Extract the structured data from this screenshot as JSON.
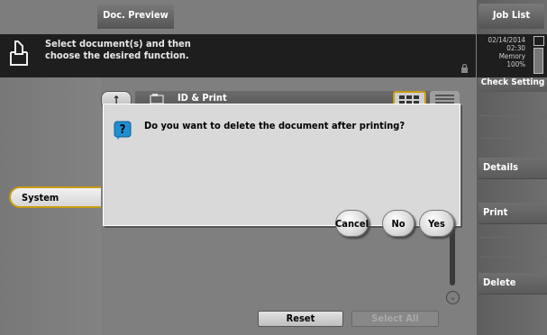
{
  "header": {
    "doc_preview_tab": "Doc. Preview",
    "job_list_tab": "Job List",
    "message": "Select document(s) and then\nchoose the desired function."
  },
  "status": {
    "date_time_memory": "02/14/2014\n02:30\nMemory\n100%"
  },
  "right_menu": {
    "check_setting": "Check Setting",
    "details": "Details",
    "print": "Print",
    "delete": "Delete"
  },
  "left_nav": {
    "system": "System"
  },
  "folder": {
    "title": "ID & Print"
  },
  "bottom": {
    "reset": "Reset",
    "select_all": "Select All"
  },
  "dialog": {
    "message": "Do you want to delete the document after printing?",
    "buttons": {
      "cancel": "Cancel",
      "no": "No",
      "yes": "Yes"
    }
  },
  "icons": {
    "doc": "document-icon",
    "lock": "lock-icon",
    "up": "up-arrow-icon",
    "folder": "folder-icon",
    "grid": "grid-view-icon",
    "list": "list-view-icon",
    "question": "question-icon",
    "scroll_down": "chevron-down-icon"
  },
  "colors": {
    "accent": "#c89b10",
    "dialog_bg": "#d9d9d9",
    "question_icon": "#1f8fd0"
  },
  "memory_level": 1.0
}
